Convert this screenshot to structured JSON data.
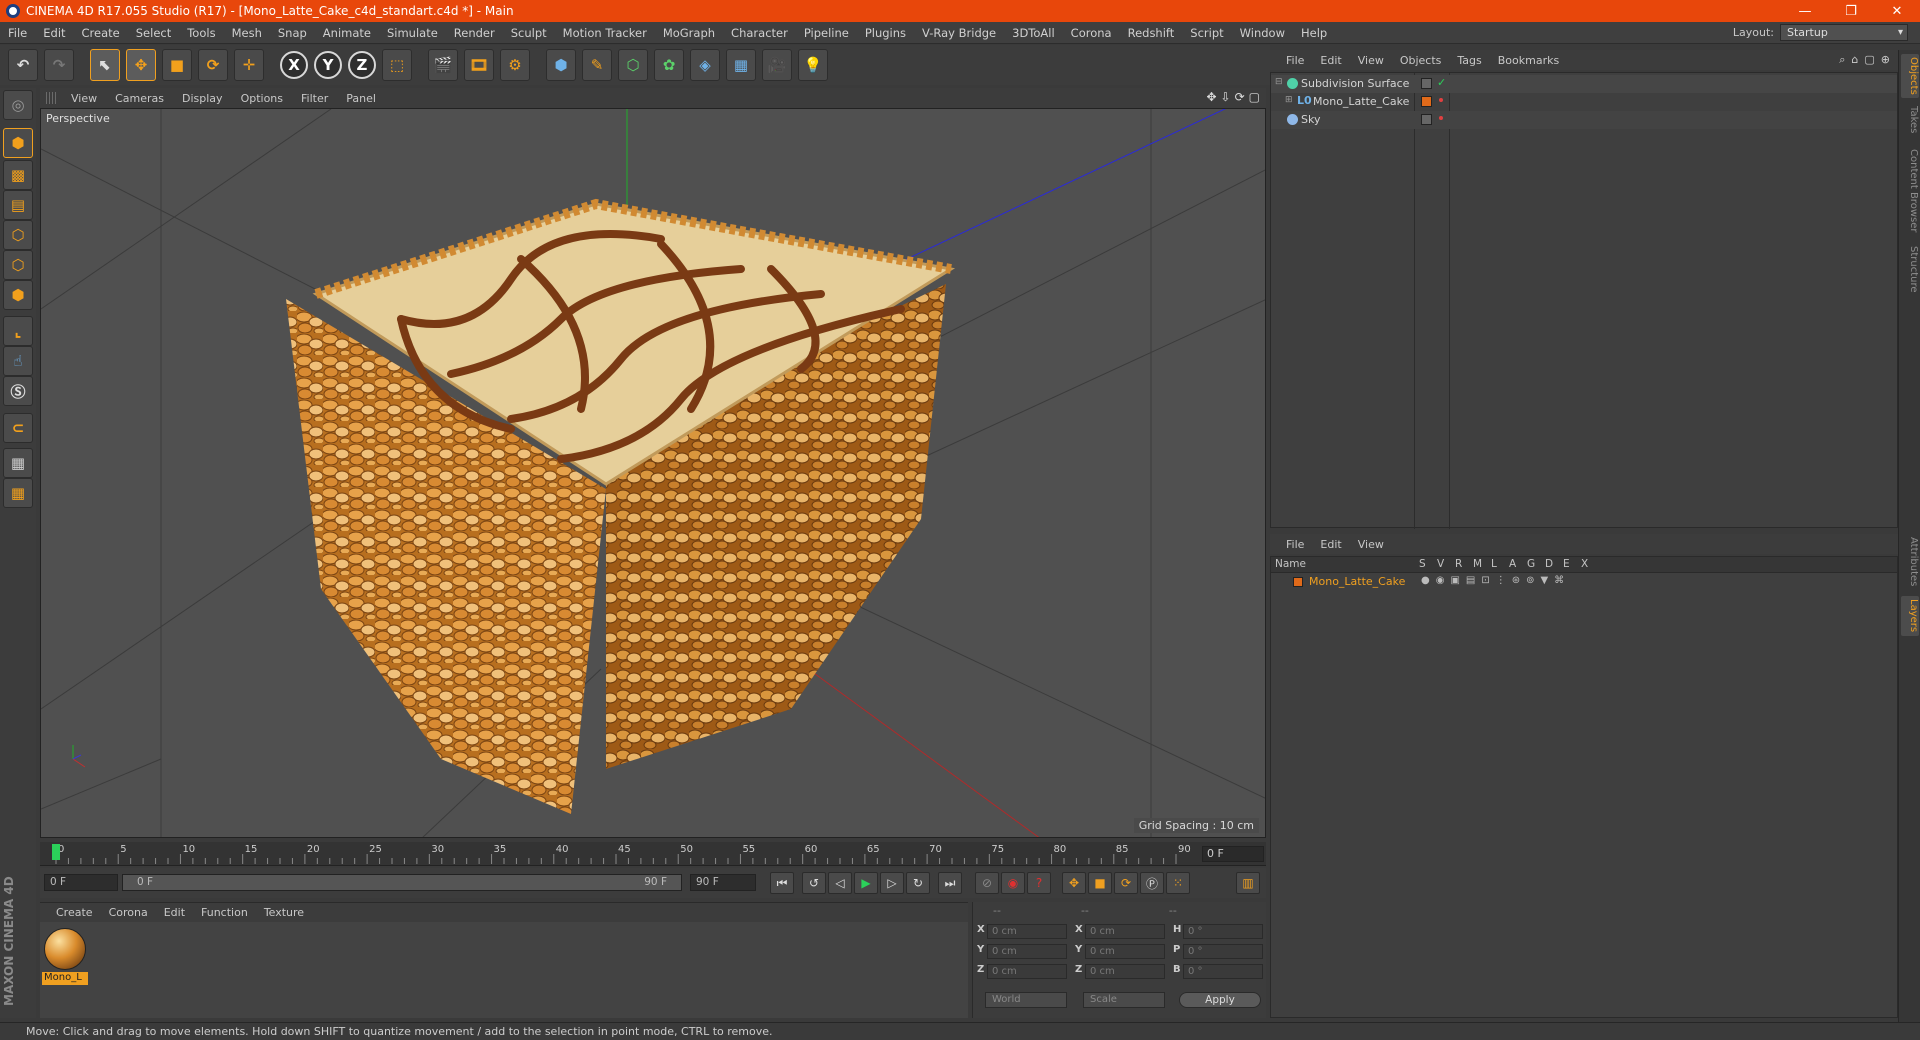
{
  "window": {
    "title": "CINEMA 4D R17.055 Studio (R17) - [Mono_Latte_Cake_c4d_standart.c4d *] - Main",
    "controls": [
      "—",
      "❐",
      "✕"
    ]
  },
  "menubar": {
    "items": [
      "File",
      "Edit",
      "Create",
      "Select",
      "Tools",
      "Mesh",
      "Snap",
      "Animate",
      "Simulate",
      "Render",
      "Sculpt",
      "Motion Tracker",
      "MoGraph",
      "Character",
      "Pipeline",
      "Plugins",
      "V-Ray Bridge",
      "3DToAll",
      "Corona",
      "Redshift",
      "Script",
      "Window",
      "Help"
    ],
    "layout_label": "Layout:",
    "layout_value": "Startup"
  },
  "toolbar": {
    "axis_x": "X",
    "axis_y": "Y",
    "axis_z": "Z"
  },
  "viewport": {
    "menu": [
      "View",
      "Cameras",
      "Display",
      "Options",
      "Filter",
      "Panel"
    ],
    "label": "Perspective",
    "grid_spacing": "Grid Spacing : 10 cm",
    "nav_icons": [
      "✥",
      "⇩",
      "⟳",
      "▢"
    ]
  },
  "timeline": {
    "ticks": [
      "0",
      "5",
      "10",
      "15",
      "20",
      "25",
      "30",
      "35",
      "40",
      "45",
      "50",
      "55",
      "60",
      "65",
      "70",
      "75",
      "80",
      "85",
      "90"
    ],
    "current_frame": "0 F"
  },
  "transport": {
    "start": "0 F",
    "range_start": "0 F",
    "range_end": "90 F",
    "end": "90 F"
  },
  "materials": {
    "menu": [
      "Create",
      "Corona",
      "Edit",
      "Function",
      "Texture"
    ],
    "items": [
      {
        "name": "Mono_L"
      }
    ]
  },
  "coordinates": {
    "headers": [
      "--",
      "--",
      "--"
    ],
    "rows": [
      {
        "a": "X",
        "av": "0 cm",
        "b": "X",
        "bv": "0 cm",
        "c": "H",
        "cv": "0 °"
      },
      {
        "a": "Y",
        "av": "0 cm",
        "b": "Y",
        "bv": "0 cm",
        "c": "P",
        "cv": "0 °"
      },
      {
        "a": "Z",
        "av": "0 cm",
        "b": "Z",
        "bv": "0 cm",
        "c": "B",
        "cv": "0 °"
      }
    ],
    "mode": "World",
    "scale": "Scale",
    "apply": "Apply"
  },
  "object_manager": {
    "menu": [
      "File",
      "Edit",
      "View",
      "Objects",
      "Tags",
      "Bookmarks"
    ],
    "objects": [
      {
        "name": "Subdivision Surface",
        "icon_color": "#4fd1a8"
      },
      {
        "name": "Mono_Latte_Cake",
        "icon_color": "#6fb2e8"
      },
      {
        "name": "Sky",
        "icon_color": "#8fb8e8"
      }
    ]
  },
  "layer_manager": {
    "menu": [
      "File",
      "Edit",
      "View"
    ],
    "columns": [
      "Name",
      "S",
      "V",
      "R",
      "M",
      "L",
      "A",
      "G",
      "D",
      "E",
      "X"
    ],
    "layers": [
      {
        "name": "Mono_Latte_Cake",
        "color": "#e06a1a"
      }
    ]
  },
  "right_tabs": [
    "Objects",
    "Takes",
    "Content Browser",
    "Structure",
    "Attributes",
    "Layers"
  ],
  "status": "Move: Click and drag to move elements. Hold down SHIFT to quantize movement / add to the selection in point mode, CTRL to remove.",
  "branding": "MAXON CINEMA 4D",
  "colors": {
    "accent": "#f0a020",
    "title_bar": "#e8470b"
  }
}
